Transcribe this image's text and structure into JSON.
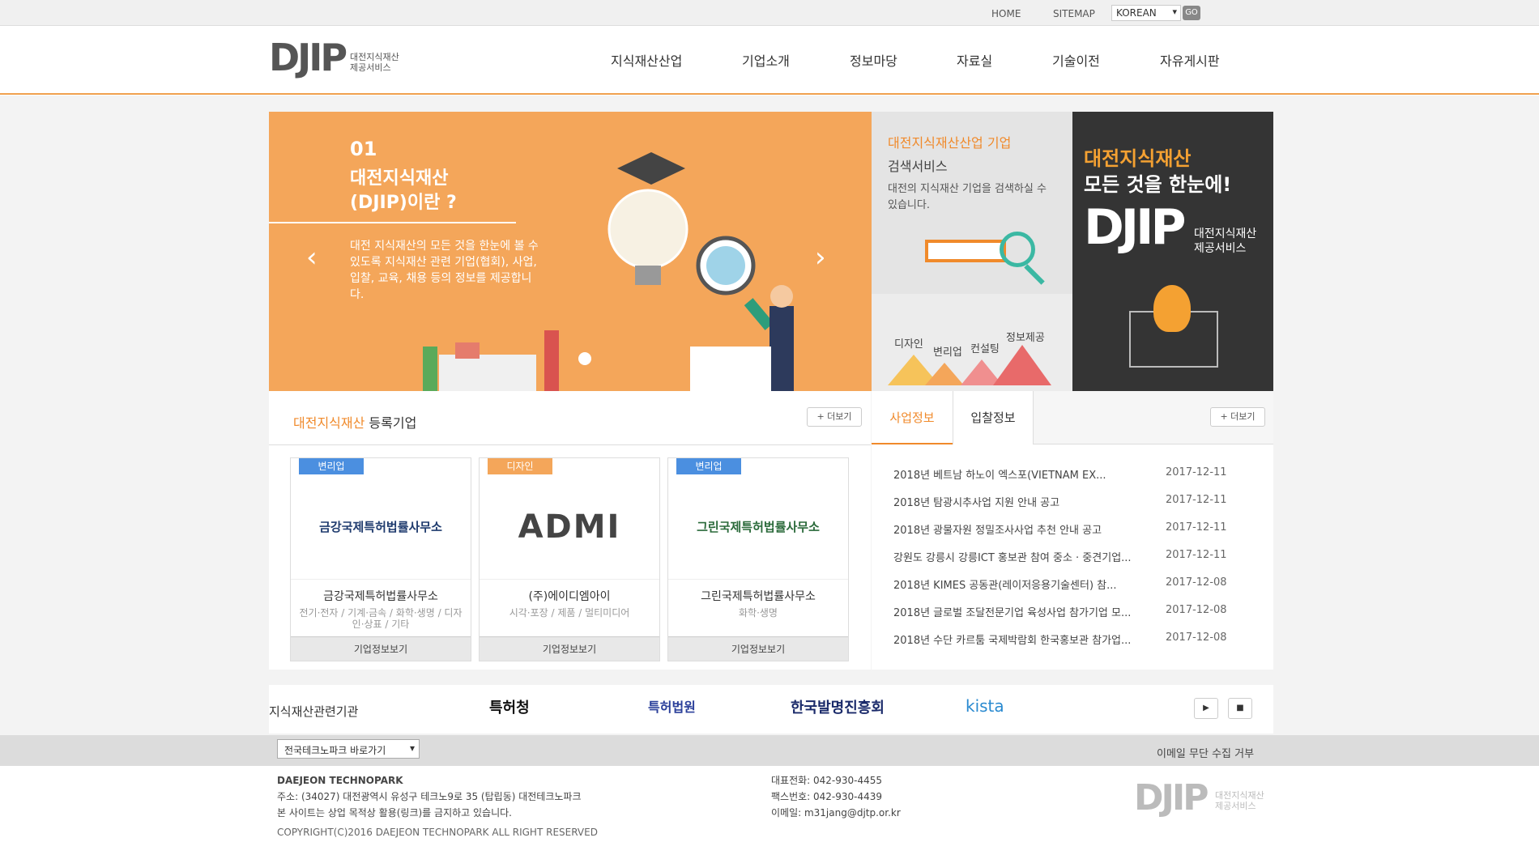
{
  "util": {
    "home": "HOME",
    "sitemap": "SITEMAP",
    "lang": "KOREAN",
    "go": "GO"
  },
  "logo": {
    "mark": "DJIP",
    "sub1": "대전지식재산",
    "sub2": "제공서비스"
  },
  "nav": [
    "지식재산산업",
    "기업소개",
    "정보마당",
    "자료실",
    "기술이전",
    "자유게시판"
  ],
  "slide": {
    "num": "01",
    "title": "대전지식재산 (DJIP)이란 ?",
    "desc": "대전 지식재산의 모든 것을 한눈에 볼 수 있도록 지식재산 관련 기업(협회), 사업, 입찰, 교육, 채용 등의 정보를 제공합니다.",
    "prev": "‹",
    "next": "›"
  },
  "search": {
    "title1": "대전지식재산산업 기업",
    "title2": "검색서비스",
    "desc": "대전의 지식재산 기업을 검색하실 수 있습니다.",
    "cats": [
      "디자인",
      "변리업",
      "컨설팅",
      "정보제공"
    ]
  },
  "promo": {
    "line1": "대전지식재산",
    "line2": "모든 것을 한눈에!",
    "mark": "DJIP",
    "sub": "대전지식재산 제공서비스"
  },
  "companies": {
    "title_hl": "대전지식재산",
    "title": " 등록기업",
    "more": "+ 더보기",
    "cards": [
      {
        "badge": "변리업",
        "logo": "금강국제특허법률사무소",
        "name": "금강국제특허법률사무소",
        "cat": "전기·전자 / 기계·금속 / 화학·생명 / 디자인·상표 / 기타",
        "btn": "기업정보보기"
      },
      {
        "badge": "디자인",
        "logo": "ADMI",
        "name": "(주)에이디엠아이",
        "cat": "시각·포장 / 제품 / 멀티미디어",
        "btn": "기업정보보기"
      },
      {
        "badge": "변리업",
        "logo": "그린국제특허법률사무소",
        "name": "그린국제특허법률사무소",
        "cat": "화학·생명",
        "btn": "기업정보보기"
      }
    ]
  },
  "colors": {
    "badge_blue": "#4b8fe0",
    "badge_orange": "#f4a65a",
    "accent": "#f08a2b"
  },
  "news": {
    "tab1": "사업정보",
    "tab2": "입찰정보",
    "more": "+ 더보기",
    "items": [
      {
        "t": "2018년 베트남 하노이 엑스포(VIETNAM EX...",
        "d": "2017-12-11"
      },
      {
        "t": "2018년 탐광시추사업 지원 안내 공고",
        "d": "2017-12-11"
      },
      {
        "t": "2018년 광물자원 정밀조사사업 추천 안내 공고",
        "d": "2017-12-11"
      },
      {
        "t": "강원도 강릉시 강릉ICT 홍보관 참여 중소 · 중견기업...",
        "d": "2017-12-11"
      },
      {
        "t": "2018년 KIMES 공동관(레이저응용기술센터) 참...",
        "d": "2017-12-08"
      },
      {
        "t": "2018년 글로벌 조달전문기업 육성사업 참가기업 모...",
        "d": "2017-12-08"
      },
      {
        "t": "2018년 수단 카르툼 국제박람회 한국홍보관 참가업...",
        "d": "2017-12-08"
      }
    ]
  },
  "orgs": {
    "title": "지식재산관련기관",
    "items": [
      "특허청",
      "특허법원",
      "한국발명진흥회",
      "kista"
    ],
    "play": "▶",
    "stop": "■"
  },
  "footer": {
    "select": "전국테크노파크 바로가기",
    "nomail": "이메일 무단 수집 거부",
    "name": "DAEJEON TECHNOPARK",
    "addr": "주소: (34027) 대전광역시 유성구 테크노9로 35 (탑립동) 대전테크노파크",
    "notice": "본 사이트는 상업 목적상 활용(링크)를 금지하고 있습니다.",
    "copy": "COPYRIGHT(C)2016 DAEJEON TECHNOPARK ALL RIGHT RESERVED",
    "tel": "대표전화: 042-930-4455",
    "fax": "팩스번호: 042-930-4439",
    "email": "이메일: m31jang@djtp.or.kr"
  }
}
